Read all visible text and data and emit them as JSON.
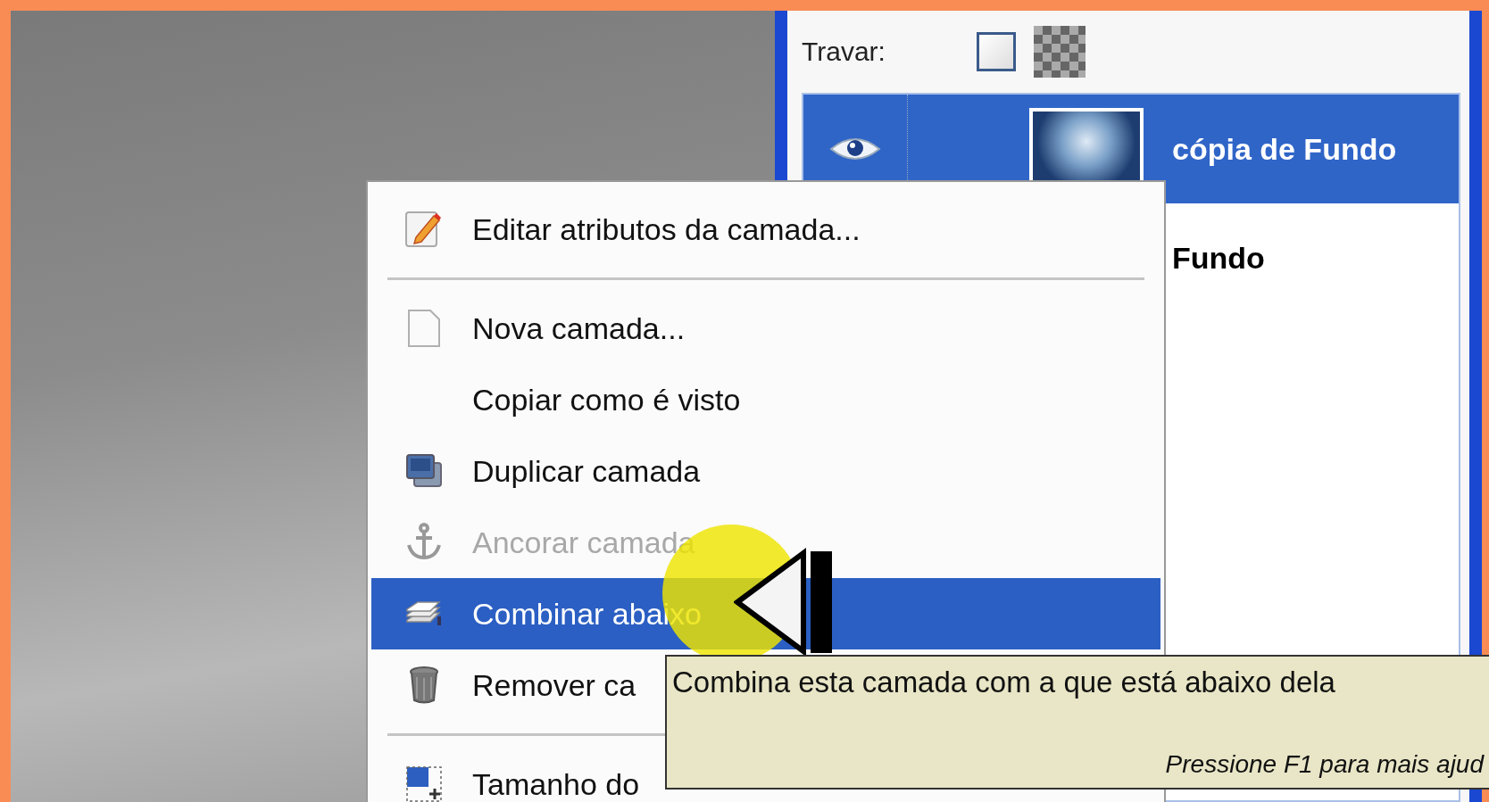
{
  "layers_panel": {
    "lock": {
      "label": "Travar:",
      "pixels_checked": false,
      "alpha_checked": false
    },
    "layers": [
      {
        "name": "cópia de Fundo",
        "selected": true
      },
      {
        "name": "Fundo",
        "selected": false
      }
    ]
  },
  "context_menu": {
    "items": [
      {
        "kind": "item",
        "label": "Editar atributos da camada...",
        "selected": false,
        "disabled": false
      },
      {
        "kind": "separator"
      },
      {
        "kind": "item",
        "label": "Nova camada...",
        "selected": false,
        "disabled": false
      },
      {
        "kind": "item",
        "label": "Copiar como é visto",
        "selected": false,
        "disabled": false
      },
      {
        "kind": "item",
        "label": "Duplicar camada",
        "selected": false,
        "disabled": false
      },
      {
        "kind": "item",
        "label": "Ancorar camada",
        "selected": false,
        "disabled": true
      },
      {
        "kind": "item",
        "label": "Combinar abaixo",
        "selected": true,
        "disabled": false
      },
      {
        "kind": "item",
        "label": "Remover ca",
        "selected": false,
        "disabled": false
      },
      {
        "kind": "separator"
      },
      {
        "kind": "item",
        "label": "Tamanho do",
        "selected": false,
        "disabled": false
      }
    ]
  },
  "tooltip": {
    "text": "Combina esta camada com a que está abaixo dela",
    "hint": "Pressione F1 para mais ajud"
  }
}
